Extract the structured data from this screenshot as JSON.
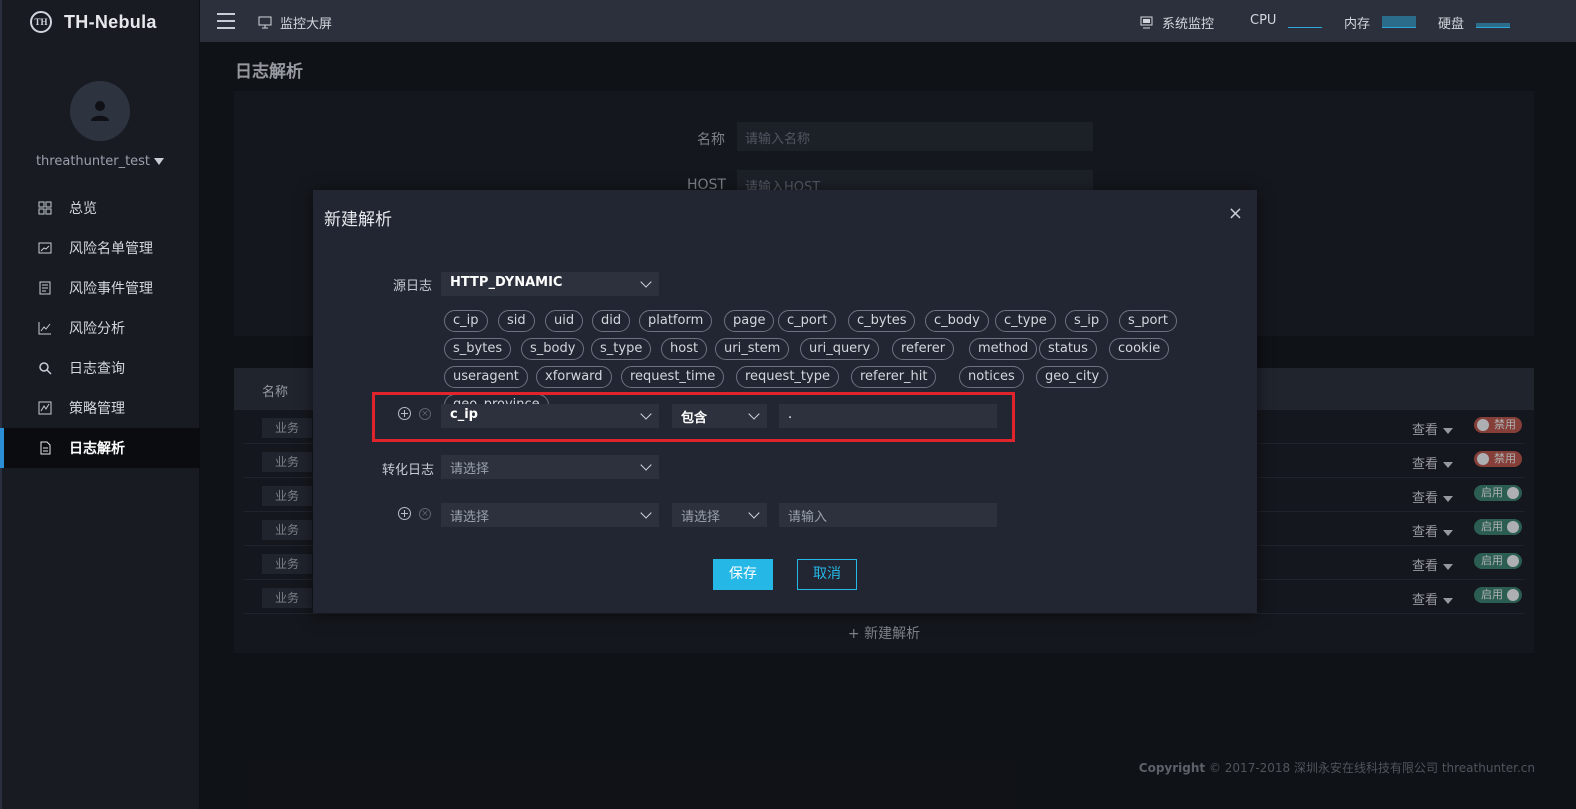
{
  "app": {
    "logo_mark": "TH",
    "name": "TH-Nebula"
  },
  "user": {
    "name": "threathunter_test"
  },
  "nav": [
    {
      "label": "总览",
      "icon": "grid-icon"
    },
    {
      "label": "风险名单管理",
      "icon": "list-chart-icon"
    },
    {
      "label": "风险事件管理",
      "icon": "document-icon"
    },
    {
      "label": "风险分析",
      "icon": "line-chart-icon"
    },
    {
      "label": "日志查询",
      "icon": "search-icon"
    },
    {
      "label": "策略管理",
      "icon": "strategy-icon"
    },
    {
      "label": "日志解析",
      "icon": "file-icon",
      "active": true
    }
  ],
  "topbar": {
    "monitor_screen": "监控大屏",
    "system_monitor": "系统监控",
    "cpu_label": "CPU",
    "memory_label": "内存",
    "disk_label": "硬盘",
    "cpu_usage": 0.05,
    "memory_usage": 0.9,
    "disk_usage": 0.35
  },
  "page": {
    "title": "日志解析",
    "form": {
      "name_label": "名称",
      "name_placeholder": "请输入名称",
      "host_label": "HOST",
      "host_placeholder": "请输入HOST"
    },
    "table": {
      "header_name": "名称",
      "rows": [
        {
          "tag": "业务",
          "action": "查看",
          "status": "禁用",
          "enabled": false
        },
        {
          "tag": "业务",
          "action": "查看",
          "status": "禁用",
          "enabled": false
        },
        {
          "tag": "业务",
          "action": "查看",
          "status": "启用",
          "enabled": true
        },
        {
          "tag": "业务",
          "action": "查看",
          "status": "启用",
          "enabled": true
        },
        {
          "tag": "业务",
          "action": "查看",
          "status": "启用",
          "enabled": true
        },
        {
          "tag": "业务",
          "action": "查看",
          "status": "启用",
          "enabled": true
        }
      ]
    },
    "new_parse": "新建解析",
    "copyright": {
      "prefix": "Copyright",
      "text": "© 2017-2018 深圳永安在线科技有限公司 threathunter.cn"
    }
  },
  "modal": {
    "title": "新建解析",
    "close": "×",
    "source_log_label": "源日志",
    "source_log_value": "HTTP_DYNAMIC",
    "fields": [
      "c_ip",
      "sid",
      "uid",
      "did",
      "platform",
      "page",
      "c_port",
      "c_bytes",
      "c_body",
      "c_type",
      "s_ip",
      "s_port",
      "s_bytes",
      "s_body",
      "s_type",
      "host",
      "uri_stem",
      "uri_query",
      "referer",
      "method",
      "status",
      "cookie",
      "useragent",
      "xforward",
      "request_time",
      "request_type",
      "referer_hit",
      "notices",
      "geo_city",
      "geo_province"
    ],
    "condition1": {
      "field": "c_ip",
      "operator": "包含",
      "value": "."
    },
    "convert_log_label": "转化日志",
    "convert_log_placeholder": "请选择",
    "condition2": {
      "field_placeholder": "请选择",
      "operator_placeholder": "请选择",
      "value_placeholder": "请输入"
    },
    "save": "保存",
    "cancel": "取消"
  },
  "colors": {
    "accent": "#25b7e6",
    "highlight": "#e0242b",
    "disabled": "#b2544b",
    "enabled": "#3a7d6e"
  }
}
